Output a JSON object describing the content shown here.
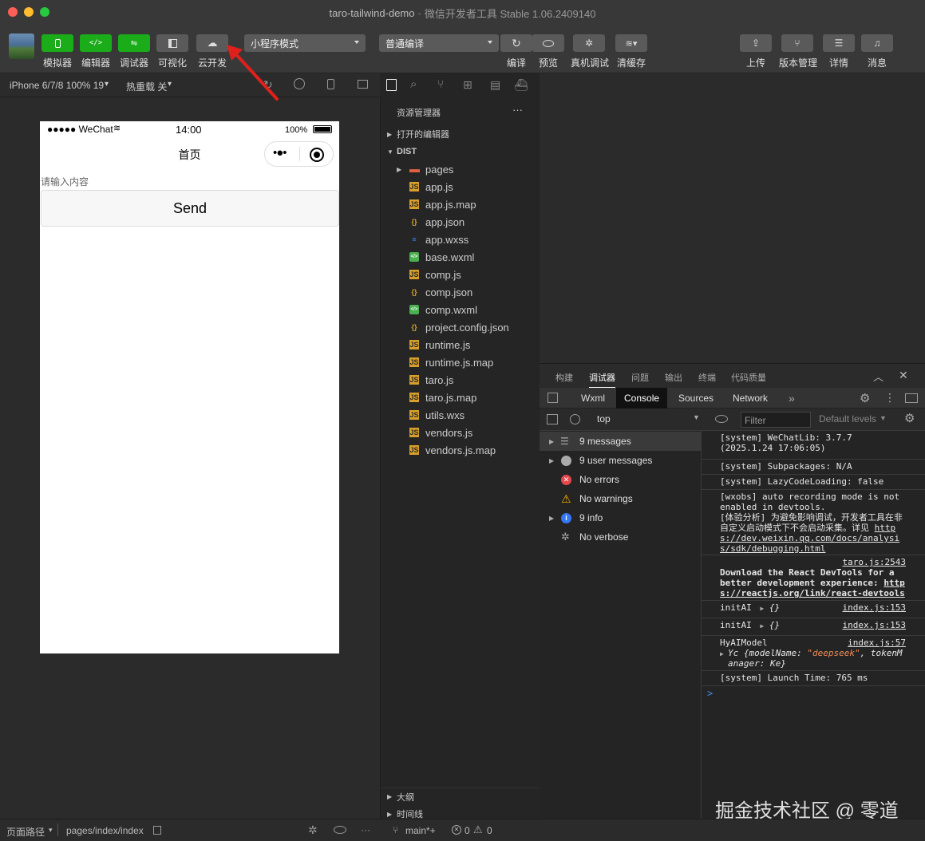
{
  "window": {
    "title": "taro-tailwind-demo",
    "subtitle": "微信开发者工具 Stable 1.06.2409140"
  },
  "toolbar": {
    "left_buttons": [
      {
        "label": "模拟器",
        "icon": "phone-icon"
      },
      {
        "label": "编辑器",
        "icon": "code-icon"
      },
      {
        "label": "调试器",
        "icon": "sliders-icon"
      },
      {
        "label": "可视化",
        "icon": "layout-icon"
      },
      {
        "label": "云开发",
        "icon": "cloud-icon"
      }
    ],
    "mode_select": "小程序模式",
    "compile_select": "普通编译",
    "mid_buttons": [
      {
        "label": "编译",
        "icon": "refresh-icon"
      },
      {
        "label": "预览",
        "icon": "eye-icon"
      },
      {
        "label": "真机调试",
        "icon": "bug-icon"
      },
      {
        "label": "清缓存",
        "icon": "layers-icon"
      }
    ],
    "right_buttons": [
      {
        "label": "上传",
        "icon": "upload-icon"
      },
      {
        "label": "版本管理",
        "icon": "branch-icon"
      },
      {
        "label": "详情",
        "icon": "menu-icon"
      },
      {
        "label": "消息",
        "icon": "bell-icon"
      }
    ]
  },
  "simulator": {
    "device": "iPhone 6/7/8 100% 19",
    "hot_reload": "热重载 关",
    "status_bar": {
      "carrier": "●●●●● WeChat",
      "time": "14:00",
      "battery": "100%"
    },
    "nav_title": "首页",
    "input_placeholder": "请输入内容",
    "send_button": "Send"
  },
  "explorer": {
    "title": "资源管理器",
    "more": "···",
    "open_editors": "打开的编辑器",
    "root": "DIST",
    "files": [
      {
        "name": "pages",
        "type": "folder"
      },
      {
        "name": "app.js",
        "type": "js"
      },
      {
        "name": "app.js.map",
        "type": "js"
      },
      {
        "name": "app.json",
        "type": "json"
      },
      {
        "name": "app.wxss",
        "type": "css"
      },
      {
        "name": "base.wxml",
        "type": "wxml"
      },
      {
        "name": "comp.js",
        "type": "js"
      },
      {
        "name": "comp.json",
        "type": "json"
      },
      {
        "name": "comp.wxml",
        "type": "wxml"
      },
      {
        "name": "project.config.json",
        "type": "json"
      },
      {
        "name": "runtime.js",
        "type": "js"
      },
      {
        "name": "runtime.js.map",
        "type": "js"
      },
      {
        "name": "taro.js",
        "type": "js"
      },
      {
        "name": "taro.js.map",
        "type": "js"
      },
      {
        "name": "utils.wxs",
        "type": "js"
      },
      {
        "name": "vendors.js",
        "type": "js"
      },
      {
        "name": "vendors.js.map",
        "type": "js"
      }
    ],
    "outline": "大纲",
    "timeline": "时间线"
  },
  "devtools": {
    "top_tabs": [
      "构建",
      "调试器",
      "问题",
      "输出",
      "终端",
      "代码质量"
    ],
    "active_top_tab": "调试器",
    "panel_tabs": [
      "Wxml",
      "Console",
      "Sources",
      "Network"
    ],
    "more_tabs": "»",
    "context": "top",
    "filter_placeholder": "Filter",
    "levels": "Default levels",
    "sidebar": [
      {
        "label": "9 messages",
        "icon": "list-icon"
      },
      {
        "label": "9 user messages",
        "icon": "user-icon"
      },
      {
        "label": "No errors",
        "icon": "error-icon"
      },
      {
        "label": "No warnings",
        "icon": "warning-icon"
      },
      {
        "label": "9 info",
        "icon": "info-icon"
      },
      {
        "label": "No verbose",
        "icon": "bug-icon"
      }
    ],
    "logs": {
      "l1a": "[system] WeChatLib: 3.7.7",
      "l1b": "(2025.1.24 17:06:05)",
      "l2": "[system] Subpackages: N/A",
      "l3": "[system] LazyCodeLoading: false",
      "l4a": "[wxobs] auto recording mode is not",
      "l4b": "enabled in devtools.",
      "l4c": "[体验分析] 为避免影响调试，开发者工具在非",
      "l4d": "自定义启动模式下不会启动采集。详见 ",
      "l4e": "http",
      "l4f": "s://dev.weixin.qq.com/docs/analysi",
      "l4g": "s/sdk/debugging.html",
      "l5src": "taro.js:2543",
      "l5a": "Download the React DevTools for a",
      "l5b": "better development experience: ",
      "l5c": "http",
      "l5d": "s://reactjs.org/link/react-devtools",
      "l6": "initAI",
      "l6obj": "{}",
      "l6src": "index.js:153",
      "l7": "initAI",
      "l7obj": "{}",
      "l7src": "index.js:153",
      "l8": "HyAIModel",
      "l8src": "index.js:57",
      "l8a": "Yc {modelName: ",
      "l8str": "\"deepseek\"",
      "l8b": ", tokenM",
      "l8c": "anager: Ke}",
      "l9": "[system] Launch Time: 765 ms",
      "prompt": ">"
    }
  },
  "statusbar": {
    "page_path_label": "页面路径",
    "page_path": "pages/index/index",
    "branch": "main*+",
    "errors": "0",
    "warnings": "0",
    "more": "···"
  },
  "watermark": "掘金技术社区 @ 零道",
  "colors": {
    "green": "#1aad19",
    "bg": "#2b2b2b",
    "arrow": "#e0201b"
  }
}
